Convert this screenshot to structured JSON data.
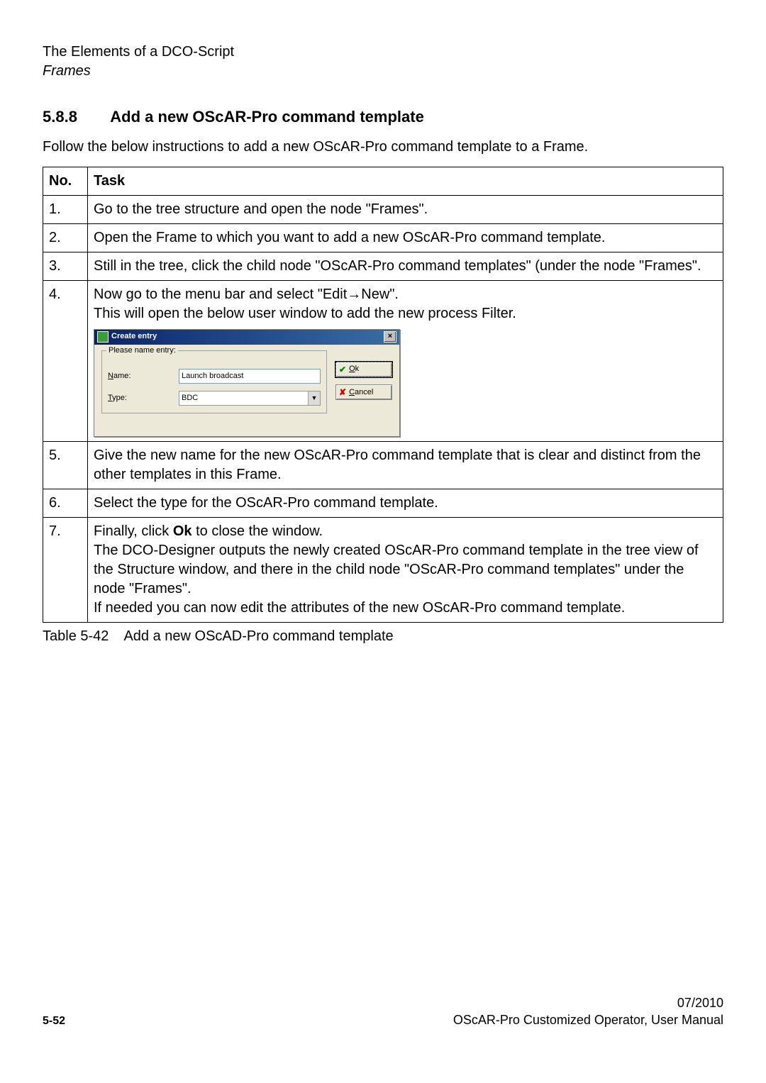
{
  "header": {
    "line1": "The Elements of a DCO-Script",
    "line2": "Frames"
  },
  "section": {
    "number": "5.8.8",
    "title": "Add a new OScAR-Pro command template",
    "intro": "Follow the below instructions to add a new OScAR-Pro command template to a Frame."
  },
  "table": {
    "head_no": "No.",
    "head_task": "Task",
    "rows": {
      "1": {
        "no": "1.",
        "text": "Go to the tree structure and open the node \"Frames\"."
      },
      "2": {
        "no": "2.",
        "text": "Open the Frame to which you want to add a new OScAR-Pro command template."
      },
      "3": {
        "no": "3.",
        "text": "Still in the tree, click the child node \"OScAR-Pro command templates\" (under the node \"Frames\"."
      },
      "4": {
        "no": "4.",
        "line1": "Now go to the menu bar and select \"Edit→New\".",
        "line2": "This will open the below user window to add the new process Filter."
      },
      "5": {
        "no": "5.",
        "text": "Give the new name for the new OScAR-Pro command template that is clear and distinct from the other templates in this Frame."
      },
      "6": {
        "no": "6.",
        "text": "Select the type for the OScAR-Pro command template."
      },
      "7": {
        "no": "7.",
        "p1a": "Finally, click ",
        "p1b": "Ok",
        "p1c": " to close the window.",
        "p2": "The DCO-Designer outputs the newly created OScAR-Pro command template in the tree view of the Structure window, and there in the child node \"OScAR-Pro command templates\" under the node \"Frames\".",
        "p3": "If needed you can now edit the attributes of the new OScAR-Pro command template."
      }
    }
  },
  "dialog": {
    "title": "Create entry",
    "group_label": "Please name entry:",
    "name_label_u": "N",
    "name_label_rest": "ame:",
    "name_value": "Launch broadcast",
    "type_label_u": "T",
    "type_label_rest": "ype:",
    "type_value": "BDC",
    "ok_u": "O",
    "ok_rest": "k",
    "cancel_u": "C",
    "cancel_rest": "ancel"
  },
  "caption": {
    "label": "Table 5-42",
    "text": "Add a new OScAD-Pro command template"
  },
  "footer": {
    "page": "5-52",
    "date": "07/2010",
    "doc": "OScAR-Pro Customized Operator, User Manual"
  }
}
